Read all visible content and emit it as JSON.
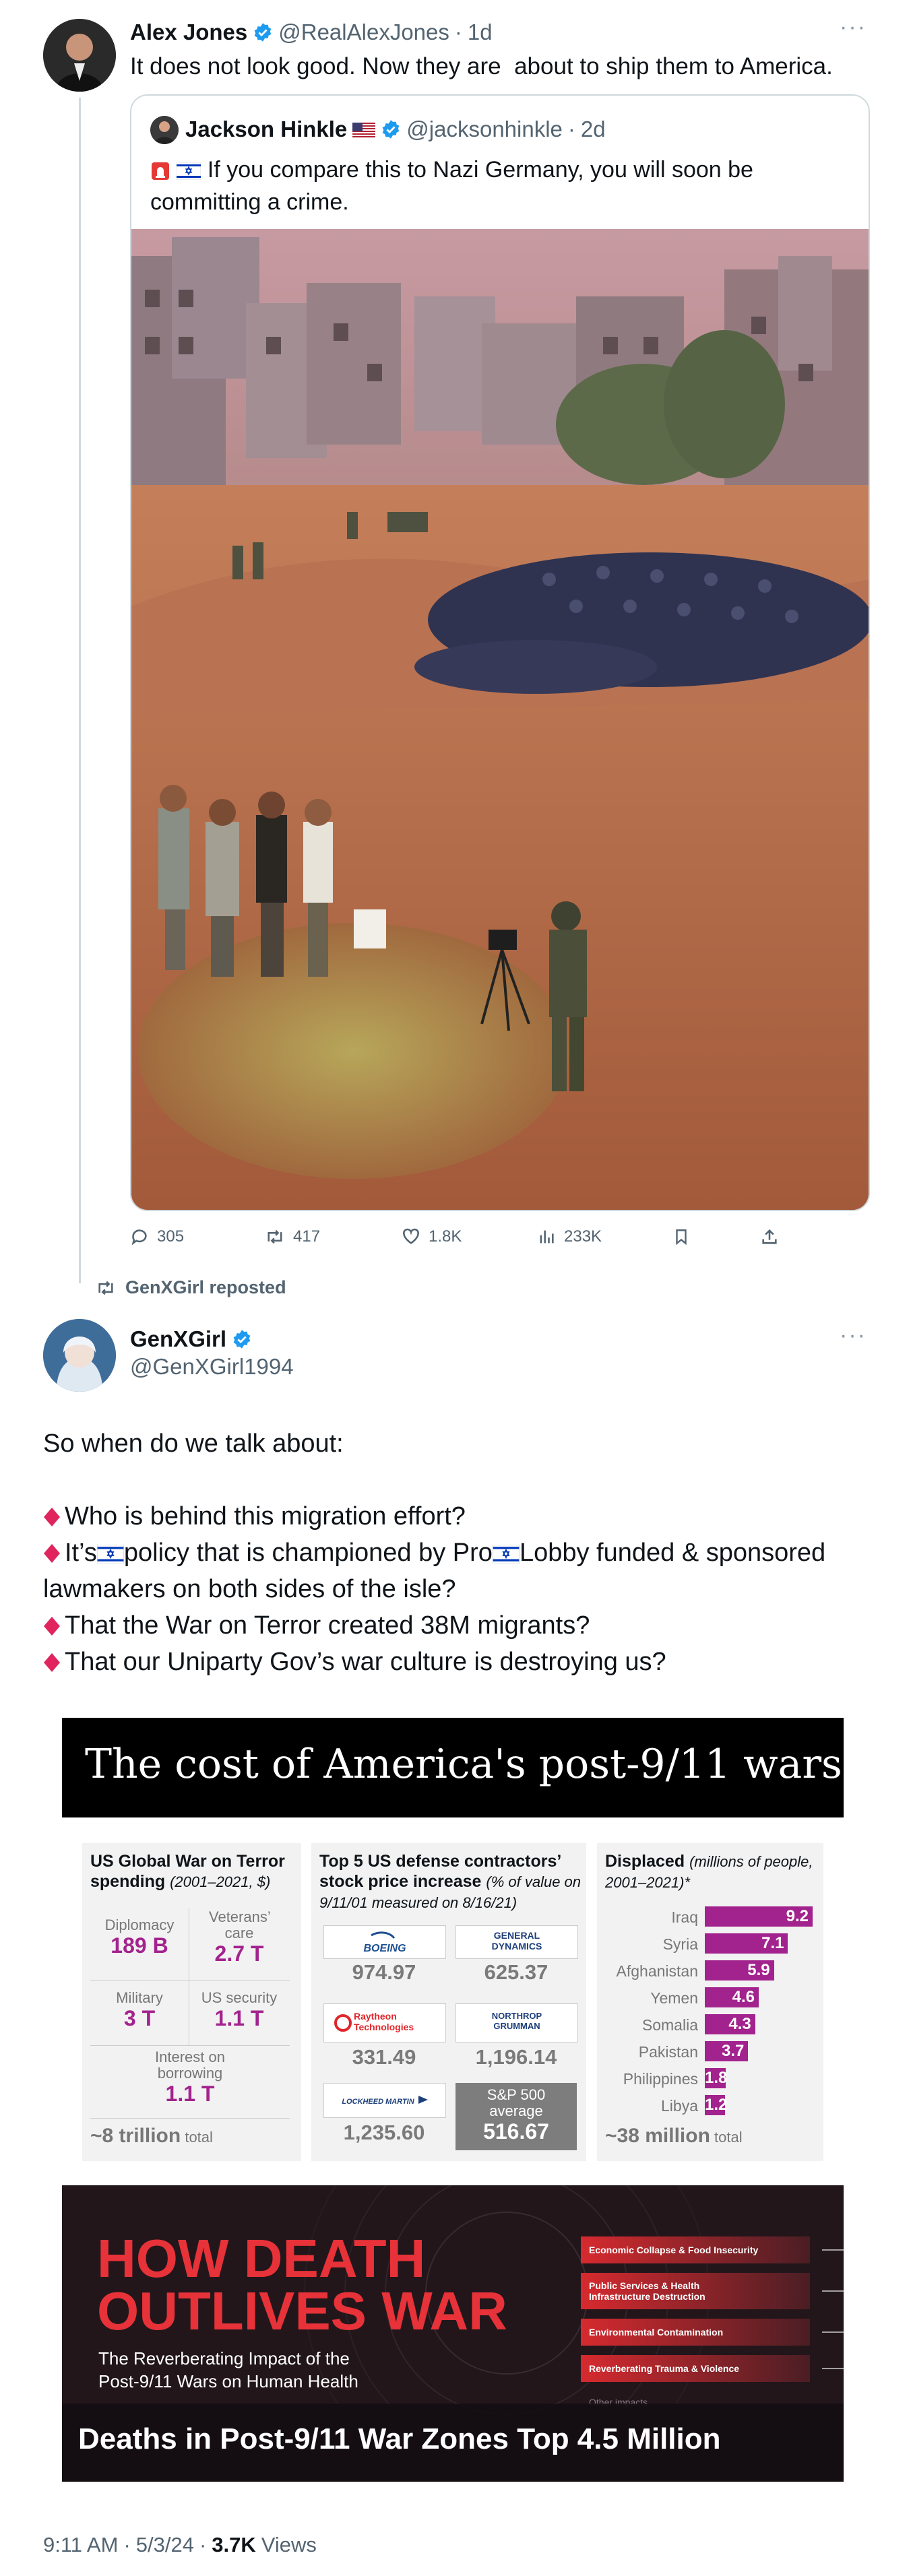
{
  "main_tweet": {
    "author_name": "Alex Jones",
    "handle": "@RealAlexJones",
    "time": "1d",
    "text": "It does not look good. Now they are  about to ship them to America."
  },
  "quoted_tweet": {
    "author_name": "Jackson Hinkle",
    "handle": "@jacksonhinkle",
    "time": "2d",
    "text": "If you compare this to Nazi Germany, you will soon be committing a crime."
  },
  "actions": {
    "replies": "305",
    "reposts": "417",
    "likes": "1.8K",
    "views": "233K"
  },
  "repost_banner": "GenXGirl reposted",
  "second_tweet": {
    "author_name": "GenXGirl",
    "handle": "@GenXGirl1994",
    "intro": "So when do we talk about:",
    "bullet1": "Who is behind this migration effort?",
    "bullet2_pre": "It’s",
    "bullet2_mid": "policy that is championed by Pro",
    "bullet2_post": "Lobby funded & sponsored lawmakers on both sides of the isle?",
    "bullet3": "That the War on Terror created 38M migrants?",
    "bullet4": "That our Uniparty Gov’s war culture is destroying us?"
  },
  "infographic": {
    "title": "The cost of America's post-9/11 wars",
    "panel1": {
      "title": "US Global War on Terror spending",
      "subtitle": "(2001–2021, $)",
      "cells": [
        {
          "label": "Diplomacy",
          "value": "189 B"
        },
        {
          "label": "Veterans’ care",
          "value": "2.7 T"
        },
        {
          "label": "Military",
          "value": "3 T"
        },
        {
          "label": "US security",
          "value": "1.1 T"
        },
        {
          "label": "Interest on borrowing",
          "value": "1.1 T"
        }
      ],
      "total_value": "~8 trillion",
      "total_unit": "total"
    },
    "panel2": {
      "title": "Top 5 US defense contractors’ stock price increase",
      "subtitle": "(% of value on 9/11/01 measured on 8/16/21)",
      "companies": [
        {
          "logo": "BOEING",
          "value": "974.97"
        },
        {
          "logo": "GENERAL DYNAMICS",
          "value": "625.37"
        },
        {
          "logo": "Raytheon Technologies",
          "value": "331.49"
        },
        {
          "logo": "NORTHROP GRUMMAN",
          "value": "1,196.14"
        },
        {
          "logo": "LOCKHEED MARTIN",
          "value": "1,235.60"
        }
      ],
      "sp_label": "S&P 500 average",
      "sp_value": "516.67"
    },
    "panel3": {
      "title": "Displaced",
      "subtitle": "(millions of people, 2001–2021)*",
      "total_value": "~38 million",
      "total_unit": "total"
    }
  },
  "chart_data": {
    "type": "bar",
    "title": "Displaced",
    "categories": [
      "Iraq",
      "Syria",
      "Afghanistan",
      "Yemen",
      "Somalia",
      "Pakistan",
      "Philippines",
      "Libya"
    ],
    "values": [
      9.2,
      7.1,
      5.9,
      4.6,
      4.3,
      3.7,
      1.8,
      1.2
    ],
    "xlim": [
      0,
      9.2
    ]
  },
  "banner": {
    "headline_line1": "HOW DEATH",
    "headline_line2": "OUTLIVES WAR",
    "subtitle_line1": "The Reverberating Impact of the",
    "subtitle_line2": "Post-9/11 Wars on Human Health",
    "impacts": [
      "Economic Collapse & Food Insecurity",
      "Public Services & Health Infrastructure Destruction",
      "Environmental Contamination",
      "Reverberating Trauma & Violence",
      "Other impacts"
    ],
    "caption": "Deaths in Post-9/11 War Zones Top 4.5 Million"
  },
  "footer": {
    "time": "9:11 AM",
    "date": "5/3/24",
    "views_count": "3.7K",
    "views_label": "Views"
  },
  "colors": {
    "accent_blue": "#1d9bf0",
    "infographic_magenta": "#a3238e",
    "banner_red": "#e63238"
  }
}
